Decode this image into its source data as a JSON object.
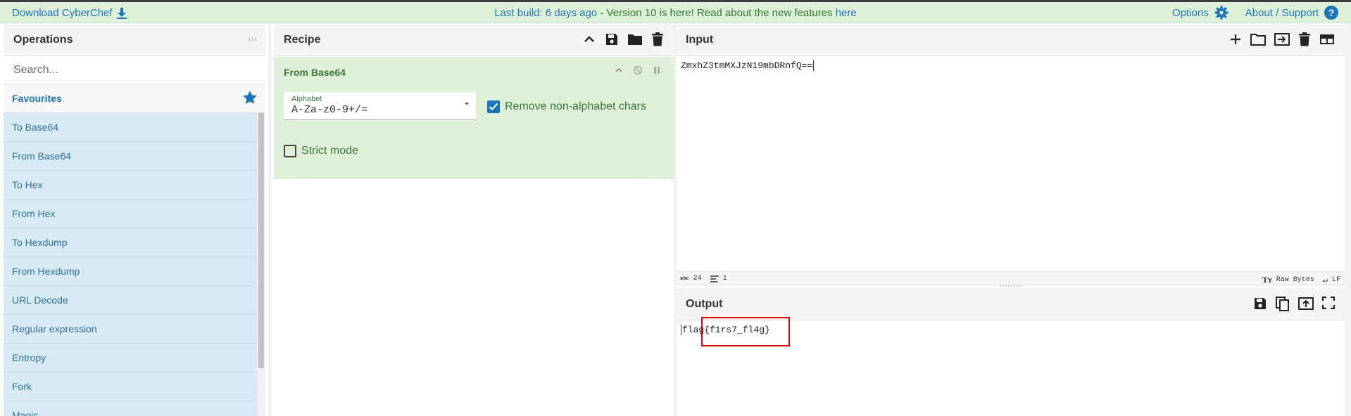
{
  "banner": {
    "download": "Download CyberChef",
    "build_link": "Last build: 6 days ago",
    "separator": " - Version 10 is here! Read about the new features ",
    "here": "here",
    "options": "Options",
    "about": "About / Support"
  },
  "operations": {
    "title": "Operations",
    "count": "456",
    "search_placeholder": "Search...",
    "favourites": "Favourites",
    "items": [
      "To Base64",
      "From Base64",
      "To Hex",
      "From Hex",
      "To Hexdump",
      "From Hexdump",
      "URL Decode",
      "Regular expression",
      "Entropy",
      "Fork",
      "Magic"
    ]
  },
  "recipe": {
    "title": "Recipe",
    "op_name": "From Base64",
    "alphabet_label": "Alphabet",
    "alphabet_value": "A-Za-z0-9+/=",
    "remove_label": "Remove non-alphabet chars",
    "remove_checked": true,
    "strict_label": "Strict mode",
    "strict_checked": false
  },
  "input": {
    "title": "Input",
    "value": "ZmxhZ3tmMXJzN19mbDRnfQ==",
    "length_icon": "abc",
    "length": "24",
    "lines": "1",
    "raw_bytes": "Raw Bytes",
    "eol": "LF"
  },
  "output": {
    "title": "Output",
    "value": "flag{f1rs7_fl4g}"
  },
  "colors": {
    "banner_bg": "#dff0d8",
    "link": "#1b75bb",
    "op_bg": "#d8ebf5",
    "recipe_op_bg": "#dff0d8",
    "highlight": "#e00000"
  }
}
